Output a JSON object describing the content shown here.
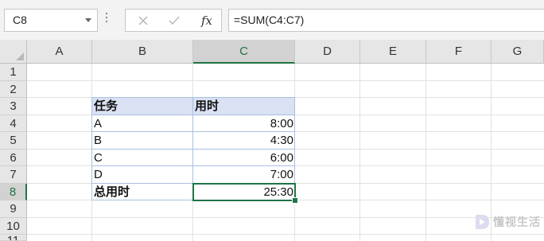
{
  "name_box": {
    "value": "C8"
  },
  "formula": {
    "value": "=SUM(C4:C7)"
  },
  "columns": [
    "A",
    "B",
    "C",
    "D",
    "E",
    "F",
    "G"
  ],
  "rows": [
    "1",
    "2",
    "3",
    "4",
    "5",
    "6",
    "7",
    "8",
    "9",
    "10",
    "11"
  ],
  "active_cell": {
    "column": "C",
    "row": "8"
  },
  "table": {
    "header": {
      "task": "任务",
      "time": "用时"
    },
    "data": [
      {
        "task": "A",
        "time": "8:00"
      },
      {
        "task": "B",
        "time": "4:30"
      },
      {
        "task": "C",
        "time": "6:00"
      },
      {
        "task": "D",
        "time": "7:00"
      }
    ],
    "total": {
      "label": "总用时",
      "value": "25:30"
    }
  },
  "colors": {
    "accent": "#217346",
    "header_fill": "#d9e1f2",
    "table_border": "#a9bfe0"
  },
  "icons": {
    "cancel": "close-icon",
    "enter": "check-icon",
    "function": "fx-icon"
  }
}
